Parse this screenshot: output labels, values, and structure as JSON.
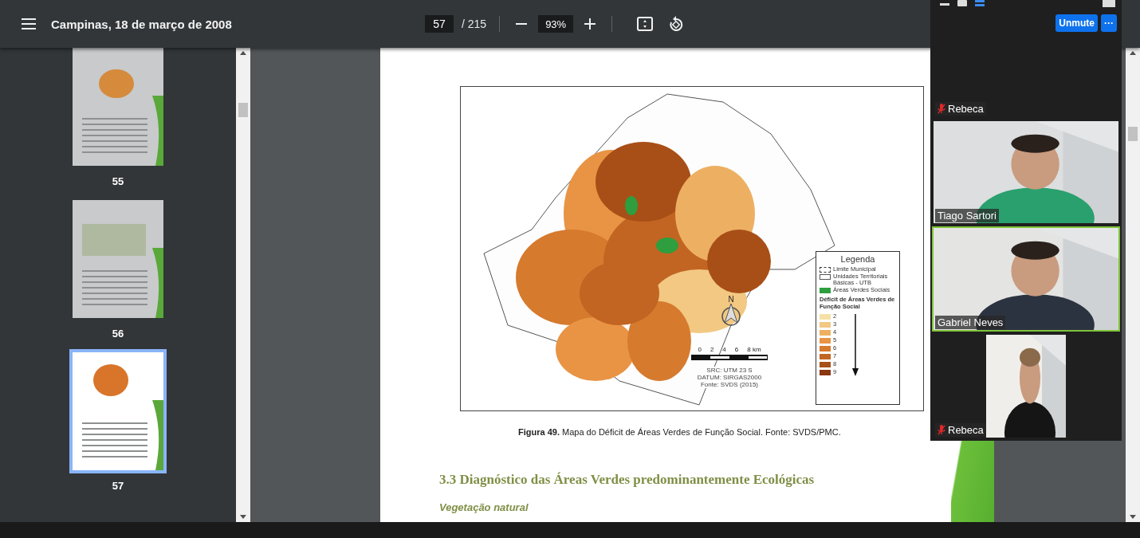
{
  "toolbar": {
    "title": "Campinas, 18 de março de 2008",
    "page": "57",
    "page_total": "/ 215",
    "zoom": "93%"
  },
  "thumbnails": [
    {
      "label": "55",
      "selected": false
    },
    {
      "label": "56",
      "selected": false
    },
    {
      "label": "57",
      "selected": true
    }
  ],
  "page": {
    "figure": {
      "legend": {
        "title": "Legenda",
        "items": [
          {
            "kind": "dashed",
            "label": "Limite Municipal"
          },
          {
            "kind": "outline",
            "label": "Unidades Territoriais Básicas - UTB"
          },
          {
            "kind": "fill",
            "color": "#2e9e3e",
            "label": "Áreas Verdes Sociais"
          }
        ],
        "scale_title": "Déficit de Áreas Verdes de Função Social",
        "classes": [
          {
            "label": "2",
            "color": "#f5e0a6"
          },
          {
            "label": "3",
            "color": "#f2c882"
          },
          {
            "label": "4",
            "color": "#edb063"
          },
          {
            "label": "5",
            "color": "#e89444"
          },
          {
            "label": "6",
            "color": "#d67a2e"
          },
          {
            "label": "7",
            "color": "#c26522"
          },
          {
            "label": "8",
            "color": "#a84f17"
          },
          {
            "label": "9",
            "color": "#8a3610"
          }
        ]
      },
      "north": "N",
      "scale_ticks": [
        "0",
        "2",
        "4",
        "6",
        "8 km"
      ],
      "credits": [
        "SRC: UTM 23 S",
        "DATUM: SIRGAS2000",
        "Fonte: SVDS (2015)"
      ]
    },
    "caption": "**Figura 49.** Mapa do Déficit de Áreas Verdes de Função Social. Fonte: SVDS/PMC.",
    "heading": "3.3 Diagnóstico das Áreas Verdes predominantemente Ecológicas",
    "subheading": "Vegetação natural"
  },
  "call": {
    "unmute": "Unmute",
    "more": "···",
    "tiles": [
      {
        "kind": "empty",
        "name": "Rebeca",
        "muted": true,
        "speaking": false
      },
      {
        "kind": "video",
        "name": "Tiago Sartori",
        "muted": false,
        "speaking": false
      },
      {
        "kind": "video",
        "name": "Gabriel Neves",
        "muted": false,
        "speaking": true
      },
      {
        "kind": "narrow",
        "name": "Rebeca",
        "muted": true,
        "speaking": false
      }
    ]
  }
}
